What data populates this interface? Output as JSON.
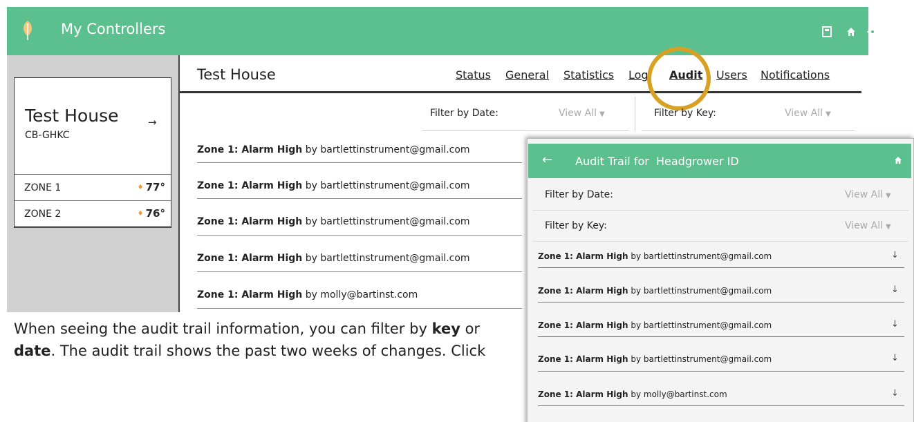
{
  "app": {
    "title": "My Controllers",
    "accent": "#5bbf8e"
  },
  "header_icons": [
    "calculator-icon",
    "home-icon",
    "gear-icon"
  ],
  "controller": {
    "name": "Test House",
    "id": "CB-GHKC",
    "arrow": "→"
  },
  "zones": [
    {
      "name": "ZONE 1",
      "temp": "77°"
    },
    {
      "name": "ZONE 2",
      "temp": "76°"
    }
  ],
  "main": {
    "title": "Test House",
    "tabs": [
      "Status",
      "General",
      "Statistics",
      "Log",
      "Audit",
      "Users",
      "Notifications"
    ],
    "active_tab": "Audit",
    "filter_date_label": "Filter by Date:",
    "filter_date_value": "View All",
    "filter_key_label": "Filter by Key:",
    "filter_key_value": "View All",
    "rows": [
      {
        "key": "Zone 1: Alarm High",
        "by": "by bartlettinstrument@gmail.com"
      },
      {
        "key": "Zone 1: Alarm High",
        "by": "by bartlettinstrument@gmail.com"
      },
      {
        "key": "Zone 1: Alarm High",
        "by": "by bartlettinstrument@gmail.com"
      },
      {
        "key": "Zone 1: Alarm High",
        "by": "by bartlettinstrument@gmail.com"
      },
      {
        "key": "Zone 1: Alarm High",
        "by": "by molly@bartinst.com"
      }
    ]
  },
  "instructions": {
    "part1": "When seeing the audit trail information, you can filter by ",
    "bold1": "key",
    "part2": " or ",
    "bold2": "date",
    "part3": ". The audit trail shows the past two weeks of changes. Click"
  },
  "popup": {
    "back": "←",
    "title": "Audit Trail for",
    "subject": "Headgrower ID",
    "filter_date_label": "Filter by Date:",
    "filter_date_value": "View All",
    "filter_key_label": "Filter by Key:",
    "filter_key_value": "View All",
    "rows": [
      {
        "key": "Zone 1: Alarm High",
        "by": "by bartlettinstrument@gmail.com"
      },
      {
        "key": "Zone 1: Alarm High",
        "by": "by bartlettinstrument@gmail.com"
      },
      {
        "key": "Zone 1: Alarm High",
        "by": "by bartlettinstrument@gmail.com"
      },
      {
        "key": "Zone 1: Alarm High",
        "by": "by bartlettinstrument@gmail.com"
      },
      {
        "key": "Zone 1: Alarm High",
        "by": "by molly@bartinst.com"
      }
    ],
    "row_arrow": "↓"
  }
}
